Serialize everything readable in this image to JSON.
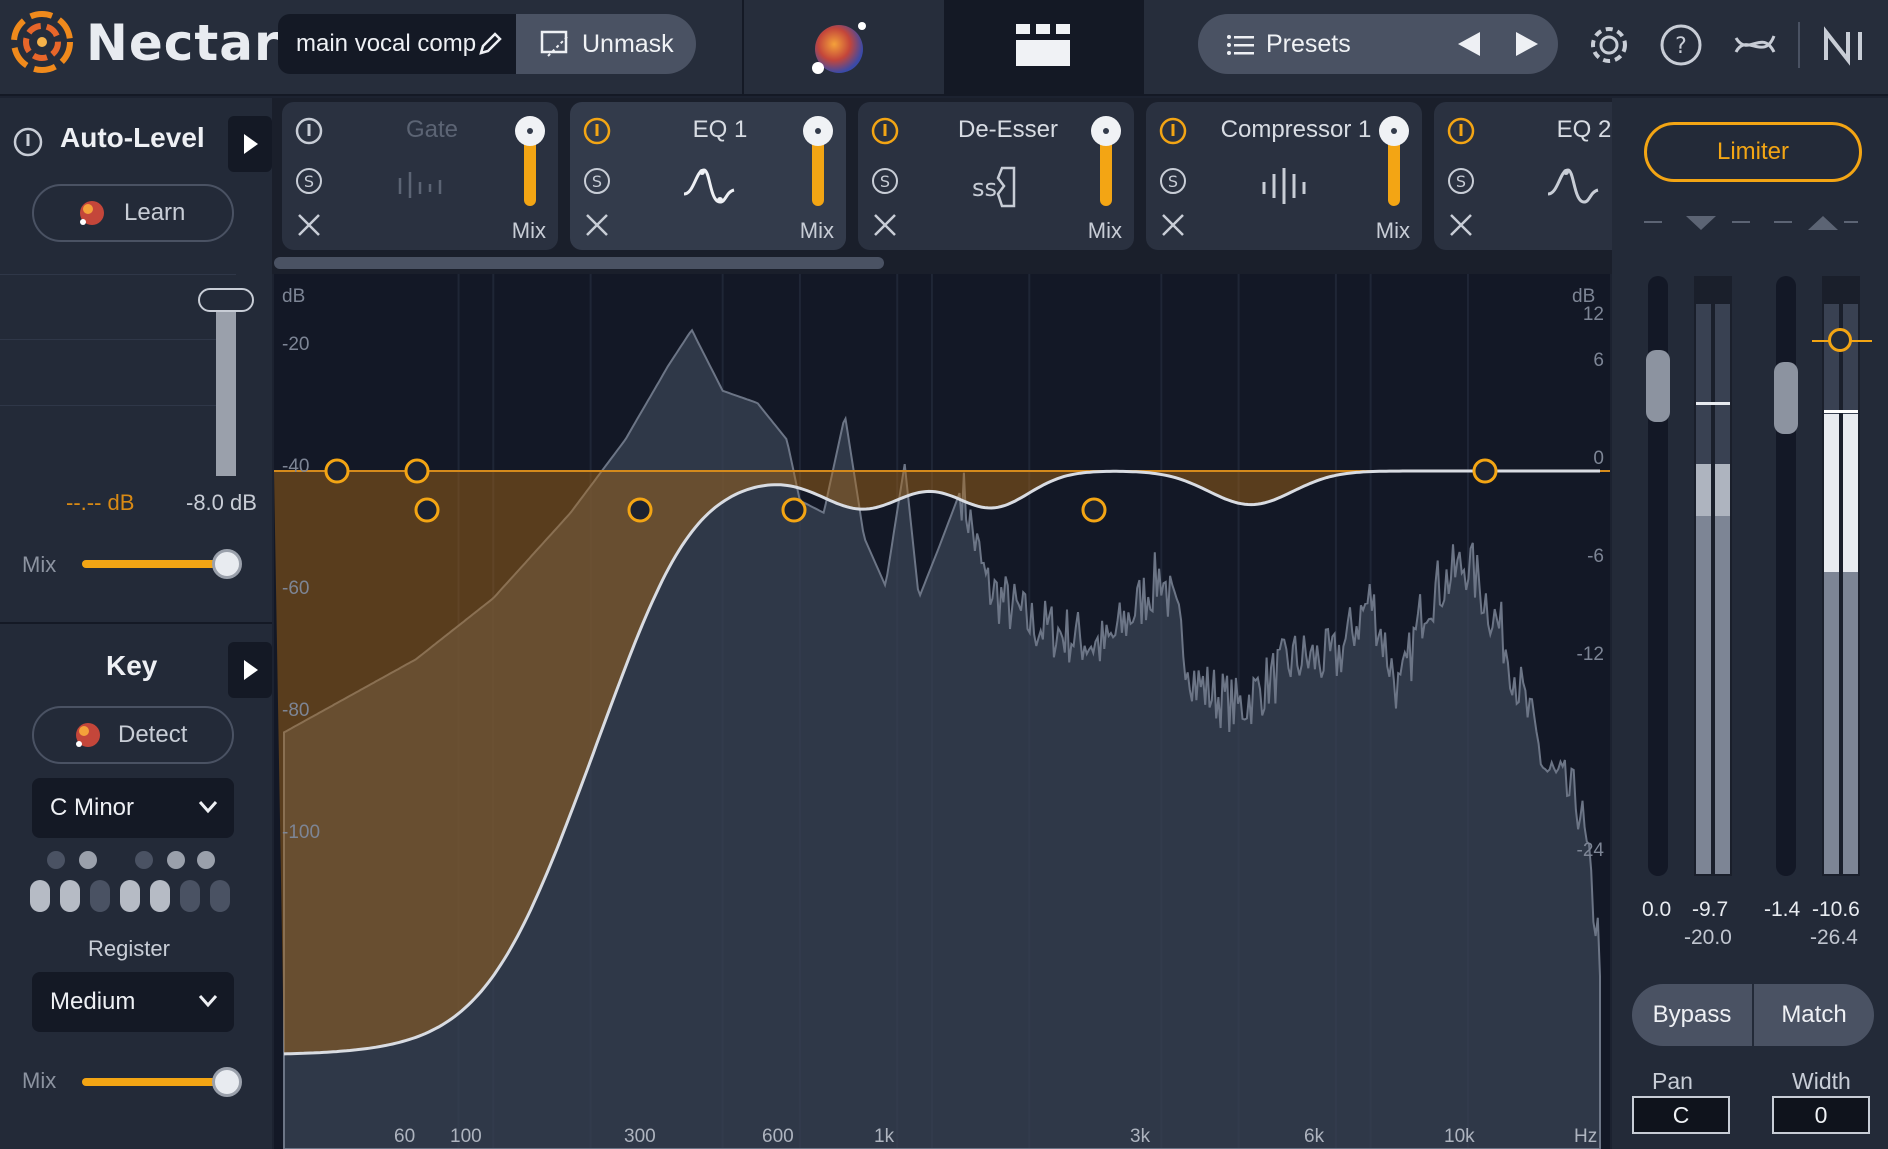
{
  "app": {
    "name": "Nectar",
    "preset_name": "main vocal comp",
    "unmask_label": "Unmask",
    "presets_label": "Presets"
  },
  "colors": {
    "accent": "#f3a514",
    "panel": "#232a38",
    "display_bg": "#131826",
    "topbar": "#262d3b"
  },
  "top_icons": [
    "settings-gear-icon",
    "help-icon",
    "relay-link-icon",
    "ni-logo-icon"
  ],
  "auto_level": {
    "title": "Auto-Level",
    "learn_label": "Learn",
    "target_value": "--.-- dB",
    "range_value": "-8.0 dB",
    "mix_label": "Mix",
    "mix_value": 0.93
  },
  "key": {
    "title": "Key",
    "detect_label": "Detect",
    "key_value": "C Minor",
    "register_label": "Register",
    "register_value": "Medium",
    "mix_label": "Mix",
    "mix_value": 0.93
  },
  "modules": [
    {
      "name": "Gate",
      "enabled": false,
      "mix_label": "Mix"
    },
    {
      "name": "EQ 1",
      "enabled": true,
      "mix_label": "Mix"
    },
    {
      "name": "De-Esser",
      "enabled": true,
      "mix_label": "Mix"
    },
    {
      "name": "Compressor 1",
      "enabled": true,
      "mix_label": "Mix"
    },
    {
      "name": "EQ 2",
      "enabled": true,
      "mix_label": "Mix"
    }
  ],
  "display": {
    "left_axis_unit": "dB",
    "left_axis_ticks": [
      "-20",
      "-40",
      "-60",
      "-80",
      "-100"
    ],
    "right_axis_unit": "dB",
    "right_axis_ticks": [
      "12",
      "6",
      "0",
      "-6",
      "-12",
      "-24"
    ],
    "freq_ticks": [
      "60",
      "100",
      "300",
      "600",
      "1k",
      "3k",
      "6k",
      "10k"
    ],
    "freq_unit": "Hz"
  },
  "limiter": {
    "label": "Limiter"
  },
  "meters": {
    "in_gain": "0.0",
    "in_peak": "-9.7",
    "in_rms": "-20.0",
    "out_gain": "-1.4",
    "out_peak": "-10.6",
    "out_rms": "-26.4"
  },
  "output": {
    "bypass_label": "Bypass",
    "match_label": "Match",
    "pan_label": "Pan",
    "pan_value": "C",
    "width_label": "Width",
    "width_value": "0"
  }
}
